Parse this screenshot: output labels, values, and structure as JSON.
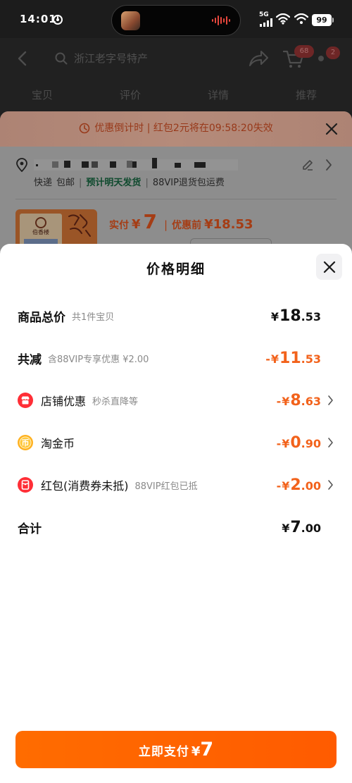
{
  "status_bar": {
    "time": "14:01",
    "network": "5G",
    "battery": "99"
  },
  "header": {
    "search_text": "浙江老字号特产",
    "cart_badge": "68",
    "more_badge": "2",
    "icons": [
      "back-icon",
      "search-icon",
      "share-icon",
      "cart-icon",
      "more-icon"
    ],
    "tabs": [
      {
        "label": "宝贝"
      },
      {
        "label": "评价"
      },
      {
        "label": "详情"
      },
      {
        "label": "推荐"
      }
    ]
  },
  "order_sheet": {
    "countdown_text": "优惠倒计时 | 红包2元将在09:58:20失效",
    "delivery": {
      "method": "快递",
      "shipping": "包邮",
      "separator": "|",
      "estimate": "预计明天发货",
      "return_policy": "88VIP退货包运费"
    },
    "product": {
      "brand": "伯香楼"
    },
    "price": {
      "paid_label": "实付",
      "currency": "¥",
      "paid_amount": "7",
      "separator": "|",
      "original_label": "优惠前",
      "original_amount": "¥18.53"
    }
  },
  "price_detail": {
    "title": "价格明细",
    "rows": [
      {
        "label": "商品总价",
        "note": "共1件宝贝",
        "currency": "¥",
        "amount_int": "18",
        "amount_dec": ".53"
      },
      {
        "label": "共减",
        "note": "含88VIP专享优惠 ¥2.00",
        "sign": "-",
        "currency": "¥",
        "amount_int": "11",
        "amount_dec": ".53"
      },
      {
        "icon": "shop-discount-icon",
        "label": "店铺优惠",
        "note": "秒杀直降等",
        "sign": "-",
        "currency": "¥",
        "amount_int": "8",
        "amount_dec": ".63"
      },
      {
        "icon": "coin-icon",
        "icon_text": "币",
        "label": "淘金币",
        "sign": "-",
        "currency": "¥",
        "amount_int": "0",
        "amount_dec": ".90"
      },
      {
        "icon": "red-packet-icon",
        "label": "红包(消费券未抵)",
        "note": "88VIP红包已抵",
        "sign": "-",
        "currency": "¥",
        "amount_int": "2",
        "amount_dec": ".00"
      },
      {
        "label": "合计",
        "currency": "¥",
        "amount_int": "7",
        "amount_dec": ".00"
      }
    ]
  },
  "pay_button": {
    "label": "立即支付",
    "currency": "¥",
    "amount": "7"
  },
  "colors": {
    "accent": "#ff5e00",
    "discount": "#f2621b",
    "text_primary": "#111111",
    "text_secondary": "#8a8a8a",
    "estimate_green": "#0f4a2e",
    "countdown_text": "#98391a"
  }
}
